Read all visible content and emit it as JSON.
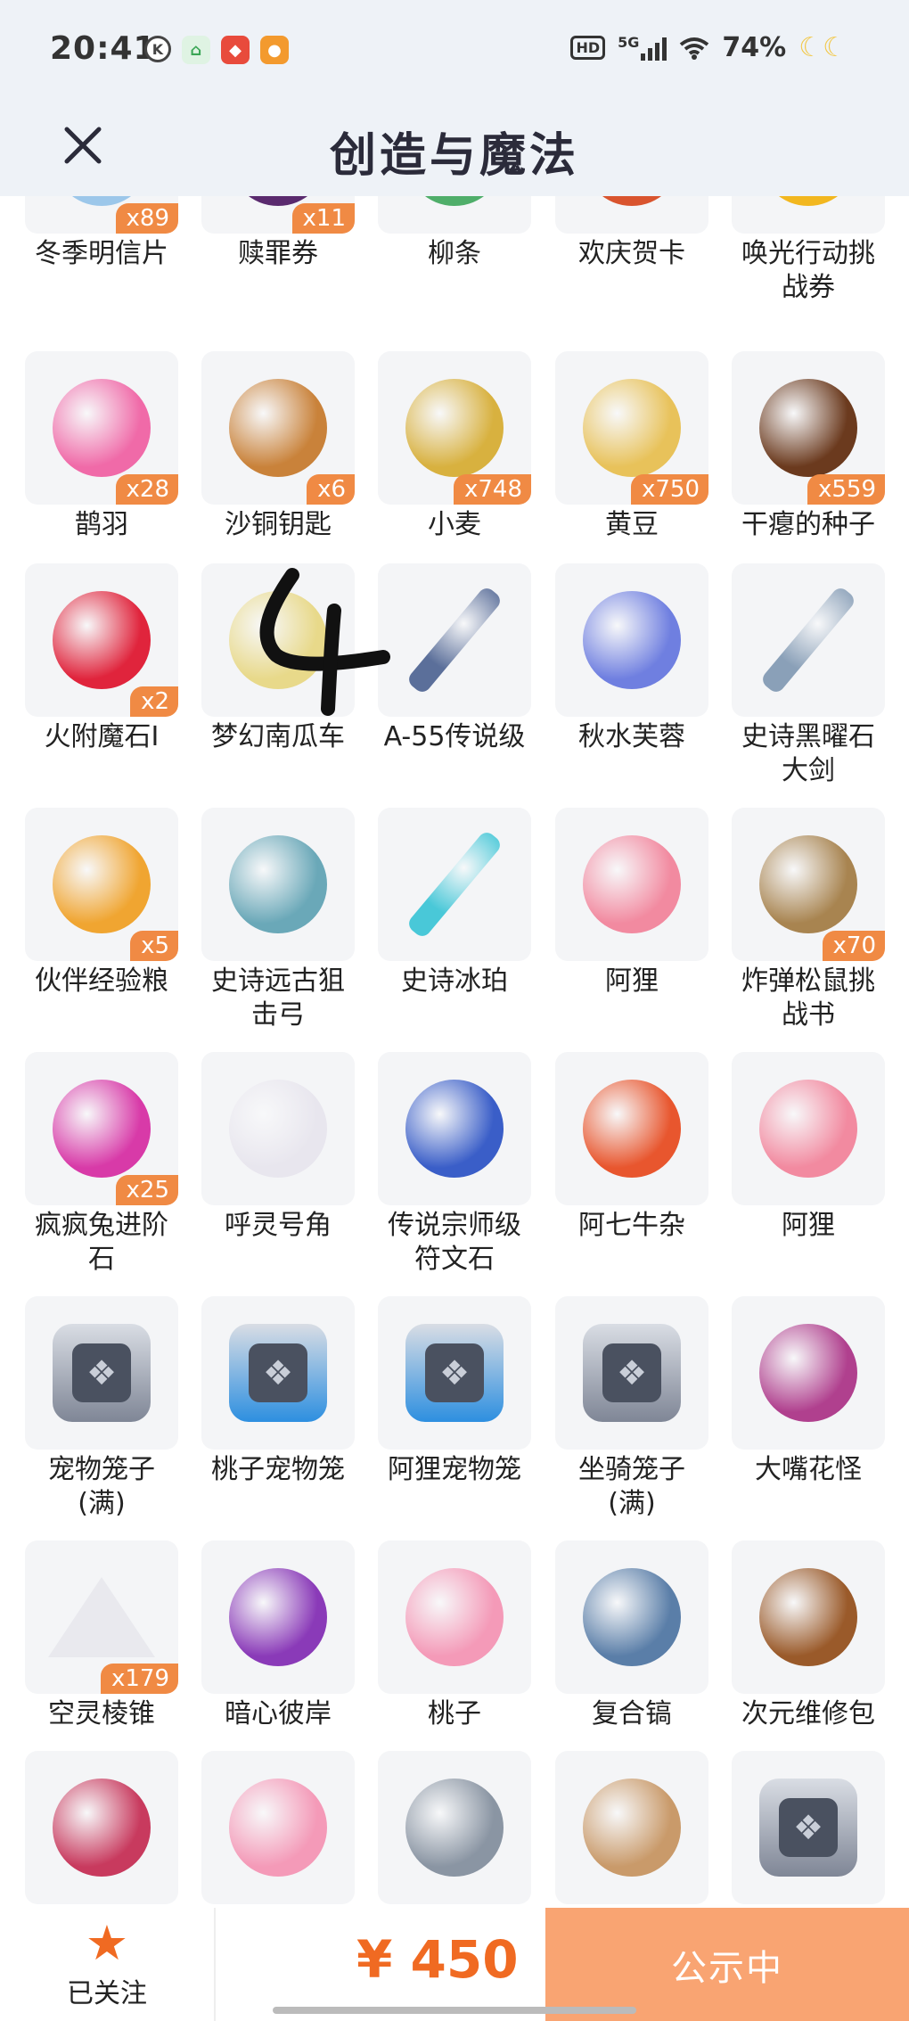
{
  "status_bar": {
    "time": "20:41",
    "battery": "74%",
    "network": "5G",
    "hd": "HD",
    "k_label": "K"
  },
  "header": {
    "title": "创造与魔法"
  },
  "items": [
    {
      "name": "冬季明信片",
      "badge": "x89",
      "icon": "postcard-icon",
      "color": "#9cc7ea"
    },
    {
      "name": "赎罪券",
      "badge": "x11",
      "icon": "ticket-icon",
      "color": "#5a2a6e"
    },
    {
      "name": "柳条",
      "badge": "",
      "icon": "willow-icon",
      "color": "#4fae6a"
    },
    {
      "name": "欢庆贺卡",
      "badge": "",
      "icon": "card-icon",
      "color": "#d9542e"
    },
    {
      "name": "唤光行动挑战券",
      "badge": "",
      "icon": "challenge-ticket-icon",
      "color": "#f2b71f"
    },
    {
      "name": "鹊羽",
      "badge": "x28",
      "icon": "feather-icon",
      "color": "#f06aa8"
    },
    {
      "name": "沙铜钥匙",
      "badge": "x6",
      "icon": "key-icon",
      "color": "#c9823a"
    },
    {
      "name": "小麦",
      "badge": "x748",
      "icon": "wheat-icon",
      "color": "#d8b13f"
    },
    {
      "name": "黄豆",
      "badge": "x750",
      "icon": "soybean-icon",
      "color": "#e8c25a"
    },
    {
      "name": "干瘪的种子",
      "badge": "x559",
      "icon": "seed-icon",
      "color": "#6b3a1e"
    },
    {
      "name": "火附魔石I",
      "badge": "x2",
      "icon": "fire-stone-icon",
      "color": "#e0243c"
    },
    {
      "name": "梦幻南瓜车",
      "badge": "",
      "icon": "carriage-icon",
      "color": "#e8d98a"
    },
    {
      "name": "A-55传说级",
      "badge": "",
      "icon": "gun-icon",
      "color": "#5b6f9a"
    },
    {
      "name": "秋水芙蓉",
      "badge": "",
      "icon": "flower-icon",
      "color": "#6f7fe0"
    },
    {
      "name": "史诗黑曜石大剑",
      "badge": "",
      "icon": "sword-icon",
      "color": "#8aa0b8"
    },
    {
      "name": "伙伴经验粮",
      "badge": "x5",
      "icon": "food-bag-icon",
      "color": "#f0a531"
    },
    {
      "name": "史诗远古狙击弓",
      "badge": "",
      "icon": "bow-icon",
      "color": "#6aa8b8"
    },
    {
      "name": "史诗冰珀",
      "badge": "",
      "icon": "spear-icon",
      "color": "#49c8d8"
    },
    {
      "name": "阿狸",
      "badge": "",
      "icon": "ahri-icon",
      "color": "#f28aa0"
    },
    {
      "name": "炸弹松鼠挑战书",
      "badge": "x70",
      "icon": "wanted-poster-icon",
      "color": "#a88450"
    },
    {
      "name": "疯疯兔进阶石",
      "badge": "x25",
      "icon": "gem-icon",
      "color": "#d83aa8"
    },
    {
      "name": "呼灵号角",
      "badge": "",
      "icon": "horn-icon",
      "color": "#e8e6ee"
    },
    {
      "name": "传说宗师级符文石",
      "badge": "",
      "icon": "rune-icon",
      "color": "#3a5ec8"
    },
    {
      "name": "阿七牛杂",
      "badge": "",
      "icon": "noodle-cup-icon",
      "color": "#e8562e"
    },
    {
      "name": "阿狸",
      "badge": "",
      "icon": "ahri-icon",
      "color": "#f28aa0"
    },
    {
      "name": "宠物笼子(满)",
      "badge": "",
      "icon": "pet-cage-icon",
      "color": "#7f8696"
    },
    {
      "name": "桃子宠物笼",
      "badge": "",
      "icon": "pet-cage-icon",
      "color": "#2d8fe0"
    },
    {
      "name": "阿狸宠物笼",
      "badge": "",
      "icon": "pet-cage-icon",
      "color": "#2d8fe0"
    },
    {
      "name": "坐骑笼子(满)",
      "badge": "",
      "icon": "mount-cage-icon",
      "color": "#7f8696"
    },
    {
      "name": "大嘴花怪",
      "badge": "",
      "icon": "plant-monster-icon",
      "color": "#b0408e"
    },
    {
      "name": "空灵棱锥",
      "badge": "x179",
      "icon": "pyramid-icon",
      "color": "#f2f2f2"
    },
    {
      "name": "暗心彼岸",
      "badge": "",
      "icon": "spider-lily-icon",
      "color": "#8a3ab8"
    },
    {
      "name": "桃子",
      "badge": "",
      "icon": "peach-bunny-icon",
      "color": "#f49ab8"
    },
    {
      "name": "复合镐",
      "badge": "",
      "icon": "pickaxe-icon",
      "color": "#5a7ea8"
    },
    {
      "name": "次元维修包",
      "badge": "",
      "icon": "repair-bag-icon",
      "color": "#9a5a2a"
    },
    {
      "name": "",
      "badge": "",
      "icon": "rune-icon",
      "color": "#c83a5e"
    },
    {
      "name": "",
      "badge": "",
      "icon": "peach-bunny-icon",
      "color": "#f49ab8"
    },
    {
      "name": "",
      "badge": "",
      "icon": "stone-icon",
      "color": "#8a95a3"
    },
    {
      "name": "",
      "badge": "",
      "icon": "deer-icon",
      "color": "#c99a6a"
    },
    {
      "name": "",
      "badge": "",
      "icon": "pet-cage-icon",
      "color": "#7f8696"
    }
  ],
  "bottom_bar": {
    "follow_label": "已关注",
    "price": "¥ 450",
    "status_label": "公示中"
  }
}
